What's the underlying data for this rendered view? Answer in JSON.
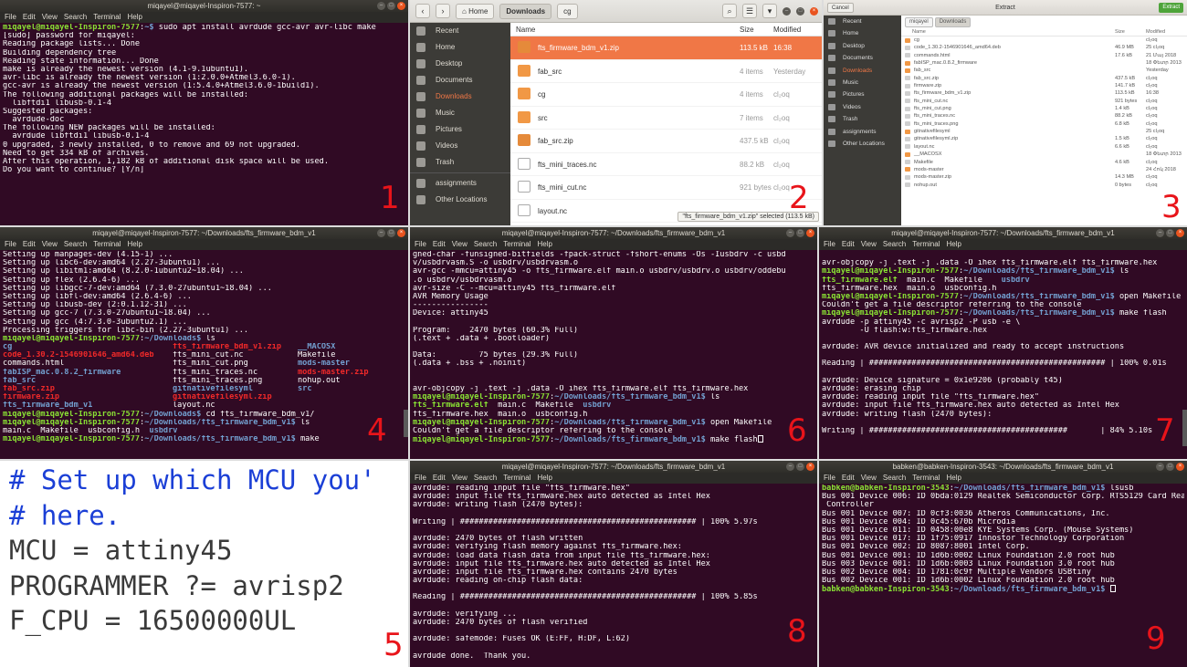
{
  "panel_numbers": [
    "1",
    "2",
    "3",
    "4",
    "5",
    "6",
    "7",
    "8",
    "9"
  ],
  "common": {
    "menu": [
      "File",
      "Edit",
      "View",
      "Search",
      "Terminal",
      "Help"
    ],
    "btn_min": "–",
    "btn_max": "□",
    "btn_close": "×"
  },
  "p1": {
    "title": "miqayel@miqayel-Inspiron-7577: ~",
    "lines": [
      "[prompt]miqayel@miqayel-Inspiron-7577:~$| sudo apt install avrdude gcc-avr avr-libc make",
      "[sudo] password for miqayel:",
      "Reading package lists... Done",
      "Building dependency tree",
      "Reading state information... Done",
      "make is already the newest version (4.1-9.1ubuntu1).",
      "avr-libc is already the newest version (1:2.0.0+Atmel3.6.0-1).",
      "gcc-avr is already the newest version (1:5.4.0+Atmel3.6.0-1build1).",
      "The following additional packages will be installed:",
      "  libftdi1 libusb-0.1-4",
      "Suggested packages:",
      "  avrdude-doc",
      "The following NEW packages will be installed:",
      "  avrdude libftdi1 libusb-0.1-4",
      "0 upgraded, 3 newly installed, 0 to remove and 69 not upgraded.",
      "Need to get 334 kB of archives.",
      "After this operation, 1,182 kB of additional disk space will be used.",
      "Do you want to continue? [Y/n] "
    ]
  },
  "p2": {
    "crumbs": [
      "Home",
      "Downloads",
      "cg"
    ],
    "sidebar": [
      {
        "label": "Recent",
        "icon": "clock-icon"
      },
      {
        "label": "Home",
        "icon": "home-icon"
      },
      {
        "label": "Desktop",
        "icon": "desktop-icon"
      },
      {
        "label": "Documents",
        "icon": "documents-icon"
      },
      {
        "label": "Downloads",
        "icon": "download-icon",
        "selected": true
      },
      {
        "label": "Music",
        "icon": "music-icon"
      },
      {
        "label": "Pictures",
        "icon": "pictures-icon"
      },
      {
        "label": "Videos",
        "icon": "videos-icon"
      },
      {
        "label": "Trash",
        "icon": "trash-icon"
      },
      {
        "label": "assignments",
        "icon": "folder-icon"
      },
      {
        "label": "Other Locations",
        "icon": "plus-icon"
      }
    ],
    "columns": {
      "name": "Name",
      "size": "Size",
      "modified": "Modified"
    },
    "files": [
      {
        "name": "fts_firmware_bdm_v1.zip",
        "size": "113.5 kB",
        "modified": "16:38",
        "type": "zip",
        "selected": true
      },
      {
        "name": "fab_src",
        "size": "4 items",
        "modified": "Yesterday",
        "type": "folder"
      },
      {
        "name": "cg",
        "size": "4 items",
        "modified": "cl₂oq",
        "type": "folder"
      },
      {
        "name": "src",
        "size": "7 items",
        "modified": "cl₂oq",
        "type": "folder"
      },
      {
        "name": "fab_src.zip",
        "size": "437.5 kB",
        "modified": "cl₂oq",
        "type": "zip"
      },
      {
        "name": "fts_mini_traces.nc",
        "size": "88.2 kB",
        "modified": "cl₂oq",
        "type": "doc"
      },
      {
        "name": "fts_mini_cut.nc",
        "size": "921 bytes",
        "modified": "cl₂oq",
        "type": "doc"
      },
      {
        "name": "layout.nc",
        "size": "",
        "modified": "",
        "type": "doc"
      }
    ],
    "status": "\"fts_firmware_bdm_v1.zip\" selected  (113.5 kB)"
  },
  "p3": {
    "title": "Extract",
    "cancel": "Cancel",
    "extract": "Extract",
    "crumbs": [
      "miqayel",
      "Downloads"
    ],
    "sidebar": [
      "Recent",
      "Home",
      "Desktop",
      "Documents",
      "Downloads",
      "Music",
      "Pictures",
      "Videos",
      "Trash",
      "assignments",
      "Other Locations"
    ],
    "columns": {
      "name": "Name",
      "size": "Size",
      "modified": "Modified"
    },
    "files": [
      {
        "name": "cg",
        "size": "",
        "modified": "cl₂oq",
        "type": "folder"
      },
      {
        "name": "code_1.30.2-1546901646_amd64.deb",
        "size": "46.9 MB",
        "modified": "25 cl₂oq",
        "type": "file"
      },
      {
        "name": "commands.html",
        "size": "17.6 kB",
        "modified": "21 Մայ 2018",
        "type": "file"
      },
      {
        "name": "fabISP_mac.0.8.2_firmware",
        "size": "",
        "modified": "18 Փետր 2013",
        "type": "folder"
      },
      {
        "name": "fab_src",
        "size": "",
        "modified": "Yesterday",
        "type": "folder"
      },
      {
        "name": "fab_src.zip",
        "size": "437.5 kB",
        "modified": "cl₂oq",
        "type": "file"
      },
      {
        "name": "firmware.zip",
        "size": "141.7 kB",
        "modified": "cl₂oq",
        "type": "file"
      },
      {
        "name": "fts_firmware_bdm_v1.zip",
        "size": "113.5 kB",
        "modified": "16:38",
        "type": "file"
      },
      {
        "name": "fts_mini_cut.nc",
        "size": "921 bytes",
        "modified": "cl₂oq",
        "type": "file"
      },
      {
        "name": "fts_mini_cut.png",
        "size": "1.4 kB",
        "modified": "cl₂oq",
        "type": "file"
      },
      {
        "name": "fts_mini_traces.nc",
        "size": "88.2 kB",
        "modified": "cl₂oq",
        "type": "file"
      },
      {
        "name": "fts_mini_traces.png",
        "size": "6.8 kB",
        "modified": "cl₂oq",
        "type": "file"
      },
      {
        "name": "gitnativefilesyml",
        "size": "",
        "modified": "25 cl₂oq",
        "type": "folder"
      },
      {
        "name": "gitnativefilesyml.zip",
        "size": "1.5 kB",
        "modified": "cl₂oq",
        "type": "file"
      },
      {
        "name": "layout.nc",
        "size": "6.6 kB",
        "modified": "cl₂oq",
        "type": "file"
      },
      {
        "name": "__MACOSX",
        "size": "",
        "modified": "18 Փետր 2013",
        "type": "folder"
      },
      {
        "name": "Makefile",
        "size": "4.6 kB",
        "modified": "cl₂oq",
        "type": "file"
      },
      {
        "name": "mods-master",
        "size": "",
        "modified": "24 Հոկ 2018",
        "type": "folder"
      },
      {
        "name": "mods-master.zip",
        "size": "14.3 MB",
        "modified": "cl₂oq",
        "type": "file"
      },
      {
        "name": "nohup.out",
        "size": "0 bytes",
        "modified": "cl₂oq",
        "type": "file"
      }
    ]
  },
  "p4": {
    "title": "miqayel@miqayel-Inspiron-7577: ~/Downloads/fts_firmware_bdm_v1",
    "lines": [
      "Setting up manpages-dev (4.15-1) ...",
      "Setting up libc6-dev:amd64 (2.27-3ubuntu1) ...",
      "Setting up libitm1:amd64 (8.2.0-1ubuntu2~18.04) ...",
      "Setting up flex (2.6.4-6) ...",
      "Setting up libgcc-7-dev:amd64 (7.3.0-27ubuntu1~18.04) ...",
      "Setting up libfl-dev:amd64 (2.6.4-6) ...",
      "Setting up libusb-dev (2:0.1.12-31) ...",
      "Setting up gcc-7 (7.3.0-27ubuntu1~18.04) ...",
      "Setting up gcc (4:7.3.0-3ubuntu2.1) ...",
      "Processing triggers for libc-bin (2.27-3ubuntu1) ...",
      "[prompt]miqayel@miqayel-Inspiron-7577:~/Downloads$| ls"
    ],
    "ls": [
      [
        {
          "t": "cg",
          "c": "blue"
        },
        {
          "t": "fts_firmware_bdm_v1.zip",
          "c": "red"
        },
        {
          "t": "__MACOSX",
          "c": "blue"
        }
      ],
      [
        {
          "t": "code_1.30.2-1546901646_amd64.deb",
          "c": "red"
        },
        {
          "t": "fts_mini_cut.nc",
          "c": "wht"
        },
        {
          "t": "Makefile",
          "c": "wht"
        }
      ],
      [
        {
          "t": "commands.html",
          "c": "wht"
        },
        {
          "t": "fts_mini_cut.png",
          "c": "wht"
        },
        {
          "t": "mods-master",
          "c": "blue"
        }
      ],
      [
        {
          "t": "fabISP_mac.0.8.2_firmware",
          "c": "blue"
        },
        {
          "t": "fts_mini_traces.nc",
          "c": "wht"
        },
        {
          "t": "mods-master.zip",
          "c": "red"
        }
      ],
      [
        {
          "t": "fab_src",
          "c": "blue"
        },
        {
          "t": "fts_mini_traces.png",
          "c": "wht"
        },
        {
          "t": "nohup.out",
          "c": "wht"
        }
      ],
      [
        {
          "t": "fab_src.zip",
          "c": "red"
        },
        {
          "t": "gitnativefilesyml",
          "c": "blue"
        },
        {
          "t": "src",
          "c": "blue"
        }
      ],
      [
        {
          "t": "firmware.zip",
          "c": "red"
        },
        {
          "t": "gitnativefilesyml.zip",
          "c": "red"
        },
        {
          "t": "",
          "c": "wht"
        }
      ],
      [
        {
          "t": "fts_firmware_bdm_v1",
          "c": "blue"
        },
        {
          "t": "layout.nc",
          "c": "wht"
        },
        {
          "t": "",
          "c": "wht"
        }
      ]
    ],
    "tail": [
      "[prompt]miqayel@miqayel-Inspiron-7577:~/Downloads$| cd fts_firmware_bdm_v1/",
      "[prompt]miqayel@miqayel-Inspiron-7577:~/Downloads/fts_firmware_bdm_v1$| ls",
      "main.c  Makefile  usbconfig.h  [blue]usbdrv",
      "[prompt]miqayel@miqayel-Inspiron-7577:~/Downloads/fts_firmware_bdm_v1$| make"
    ]
  },
  "p5": {
    "lines": [
      {
        "t": "# Set up which MCU you'",
        "c": "cm"
      },
      {
        "t": "# here.",
        "c": "cm"
      },
      {
        "t": "MCU = attiny45",
        "c": "cd"
      },
      {
        "t": "PROGRAMMER ?= avrisp2",
        "c": "cd"
      },
      {
        "t": "F_CPU = 16500000UL",
        "c": "cd"
      }
    ]
  },
  "p6": {
    "title": "miqayel@miqayel-Inspiron-7577: ~/Downloads/fts_firmware_bdm_v1",
    "lines": [
      "gned-char -funsigned-bitfields -fpack-struct -fshort-enums -Os -Iusbdrv -c usbd",
      "v/usbdrvasm.S -o usbdrv/usbdrvasm.o",
      "avr-gcc -mmcu=attiny45 -o fts_firmware.elf main.o usbdrv/usbdrv.o usbdrv/oddebu",
      ".o usbdrv/usbdrvasm.o",
      "avr-size -C --mcu=attiny45 fts_firmware.elf",
      "AVR Memory Usage",
      "----------------",
      "Device: attiny45",
      "",
      "Program:    2470 bytes (60.3% Full)",
      "(.text + .data + .bootloader)",
      "",
      "Data:         75 bytes (29.3% Full)",
      "(.data + .bss + .noinit)",
      "",
      "",
      "avr-objcopy -j .text -j .data -O ihex fts_firmware.elf fts_firmware.hex",
      "[prompt]miqayel@miqayel-Inspiron-7577:~/Downloads/fts_firmware_bdm_v1$| ls",
      "[bold]fts_firmware.elf[/]  main.c  Makefile  [blue]usbdrv",
      "fts_firmware.hex  main.o  usbconfig.h",
      "[prompt]miqayel@miqayel-Inspiron-7577:~/Downloads/fts_firmware_bdm_v1$| open Makefile",
      "Couldn't get a file descriptor referring to the console",
      "[prompt]miqayel@miqayel-Inspiron-7577:~/Downloads/fts_firmware_bdm_v1$| make flash"
    ]
  },
  "p7": {
    "title": "miqayel@miqayel-Inspiron-7577: ~/Downloads/fts_firmware_bdm_v1",
    "lines": [
      "",
      "avr-objcopy -j .text -j .data -O ihex fts_firmware.elf fts_firmware.hex",
      "[prompt]miqayel@miqayel-Inspiron-7577:~/Downloads/fts_firmware_bdm_v1$| ls",
      "[bold]fts_firmware.elf[/]  main.c  Makefile    [blue]usbdrv",
      "fts_firmware.hex  main.o  usbconfig.h",
      "[prompt]miqayel@miqayel-Inspiron-7577:~/Downloads/fts_firmware_bdm_v1$| open Makefile",
      "Couldn't get a file descriptor referring to the console",
      "[prompt]miqayel@miqayel-Inspiron-7577:~/Downloads/fts_firmware_bdm_v1$| make flash",
      "avrdude -p attiny45 -c avrisp2 -P usb -e \\",
      "        -U flash:w:fts_firmware.hex",
      "",
      "avrdude: AVR device initialized and ready to accept instructions",
      "",
      "Reading | ################################################## | 100% 0.01s",
      "",
      "avrdude: Device signature = 0x1e9206 (probably t45)",
      "avrdude: erasing chip",
      "avrdude: reading input file \"fts_firmware.hex\"",
      "avrdude: input file fts_firmware.hex auto detected as Intel Hex",
      "avrdude: writing flash (2470 bytes):",
      "",
      "Writing | ##########################################       | 84% 5.10s"
    ]
  },
  "p8": {
    "title": "miqayel@miqayel-Inspiron-7577: ~/Downloads/fts_firmware_bdm_v1",
    "lines": [
      "avrdude: reading input file \"fts_firmware.hex\"",
      "avrdude: input file fts_firmware.hex auto detected as Intel Hex",
      "avrdude: writing flash (2470 bytes):",
      "",
      "Writing | ################################################## | 100% 5.97s",
      "",
      "avrdude: 2470 bytes of flash written",
      "avrdude: verifying flash memory against fts_firmware.hex:",
      "avrdude: load data flash data from input file fts_firmware.hex:",
      "avrdude: input file fts_firmware.hex auto detected as Intel Hex",
      "avrdude: input file fts_firmware.hex contains 2470 bytes",
      "avrdude: reading on-chip flash data:",
      "",
      "Reading | ################################################## | 100% 5.85s",
      "",
      "avrdude: verifying ...",
      "avrdude: 2470 bytes of flash verified",
      "",
      "avrdude: safemode: Fuses OK (E:FF, H:DF, L:62)",
      "",
      "avrdude done.  Thank you.",
      "",
      "[prompt]miqayel@miqayel-Inspiron-7577:~/Downloads/fts_firmware_bdm_v1$| make  fuses"
    ]
  },
  "p9": {
    "title": "babken@babken-Inspiron-3543: ~/Downloads/fts_firmware_bdm_v1",
    "lines": [
      "[prompt]babken@babken-Inspiron-3543:~/Downloads/fts_firmware_bdm_v1$| lsusb",
      "Bus 001 Device 006: ID 0bda:0129 Realtek Semiconductor Corp. RTS5129 Card Reader",
      " Controller",
      "Bus 001 Device 007: ID 0cf3:0036 Atheros Communications, Inc.",
      "Bus 001 Device 004: ID 0c45:670b Microdia",
      "Bus 001 Device 011: ID 0458:00e8 KYE Systems Corp. (Mouse Systems)",
      "Bus 001 Device 017: ID 1f75:0917 Innostor Technology Corporation",
      "Bus 001 Device 002: ID 8087:8001 Intel Corp.",
      "Bus 001 Device 001: ID 1d6b:0002 Linux Foundation 2.0 root hub",
      "Bus 003 Device 001: ID 1d6b:0003 Linux Foundation 3.0 root hub",
      "Bus 002 Device 004: ID 1781:0c9f Multiple Vendors USBtiny",
      "Bus 002 Device 001: ID 1d6b:0002 Linux Foundation 2.0 root hub",
      "[prompt]babken@babken-Inspiron-3543:~/Downloads/fts_firmware_bdm_v1$| "
    ]
  }
}
